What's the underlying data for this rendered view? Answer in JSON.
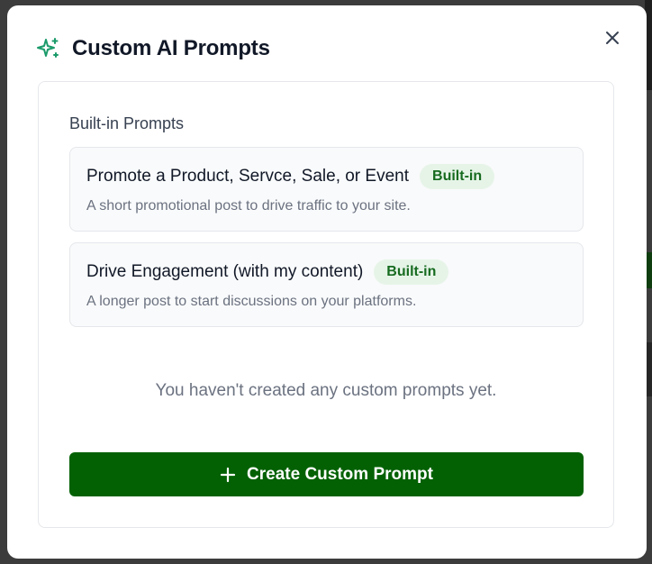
{
  "modal": {
    "title": "Custom AI Prompts",
    "title_icon": "sparkle-icon",
    "close_icon": "close-icon"
  },
  "builtin_section": {
    "heading": "Built-in Prompts",
    "prompts": [
      {
        "title": "Promote a Product, Servce, Sale, or Event",
        "badge": "Built-in",
        "description": "A short promotional post to drive traffic to your site."
      },
      {
        "title": "Drive Engagement (with my content)",
        "badge": "Built-in",
        "description": "A longer post to start discussions on your platforms."
      }
    ]
  },
  "empty_state": {
    "message": "You haven't created any custom prompts yet."
  },
  "create_button": {
    "label": "Create Custom Prompt",
    "icon": "plus-icon"
  },
  "colors": {
    "accent_green": "#036103",
    "icon_green": "#1a9a6a",
    "badge_bg": "#e6f4e8",
    "badge_text": "#166b1f"
  }
}
